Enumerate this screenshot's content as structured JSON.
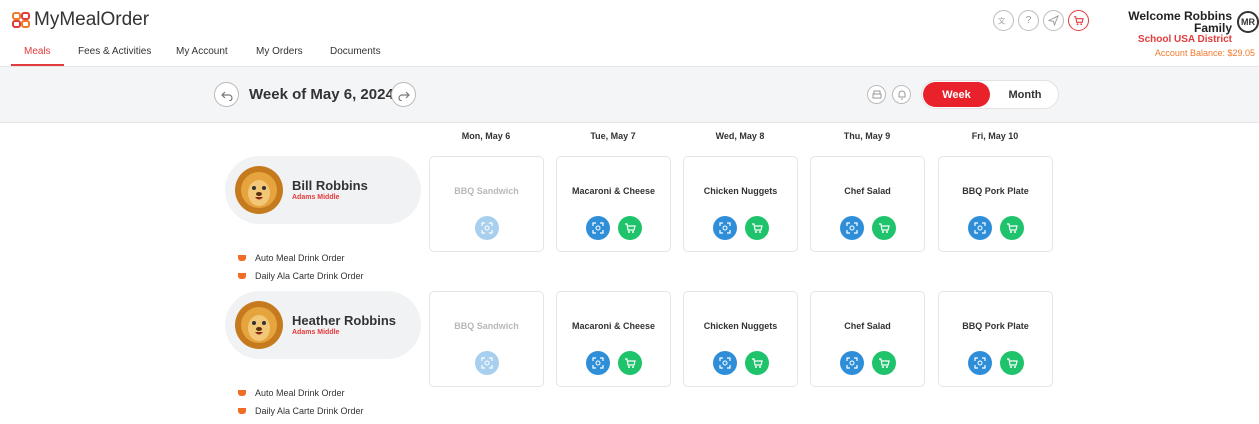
{
  "app": {
    "logo_text": "MyMealOrder",
    "brand_color": "#e23b3b"
  },
  "header": {
    "welcome": "Welcome Robbins Family",
    "district": "School USA District",
    "avatar_initials": "MR",
    "icons": [
      "translate-icon",
      "help-icon",
      "send-icon",
      "cart-icon"
    ]
  },
  "nav": {
    "items": [
      "Meals",
      "Fees & Activities",
      "My Account",
      "My Orders",
      "Documents"
    ],
    "active": "Meals",
    "balance": "Account Balance: $29.05"
  },
  "week": {
    "title": "Week of May 6, 2024",
    "view_week": "Week",
    "view_month": "Month",
    "active_view": "Week"
  },
  "days": [
    "Mon, May 6",
    "Tue, May 7",
    "Wed, May 8",
    "Thu, May 9",
    "Fri, May 10"
  ],
  "students": [
    {
      "name": "Bill Robbins",
      "school": "Adams Middle",
      "meals": [
        "BBQ Sandwich",
        "Macaroni & Cheese",
        "Chicken Nuggets",
        "Chef Salad",
        "BBQ Pork Plate"
      ],
      "drinks": [
        "Auto Meal Drink Order",
        "Daily Ala Carte Drink Order"
      ]
    },
    {
      "name": "Heather Robbins",
      "school": "Adams Middle",
      "meals": [
        "BBQ Sandwich",
        "Macaroni & Cheese",
        "Chicken Nuggets",
        "Chef Salad",
        "BBQ Pork Plate"
      ],
      "drinks": [
        "Auto Meal Drink Order",
        "Daily Ala Carte Drink Order"
      ]
    }
  ],
  "colors": {
    "view_button": "#2f8ed8",
    "cart_button": "#1fc36b",
    "drink_icon": "#f06d25",
    "balance": "#f07a2b"
  }
}
